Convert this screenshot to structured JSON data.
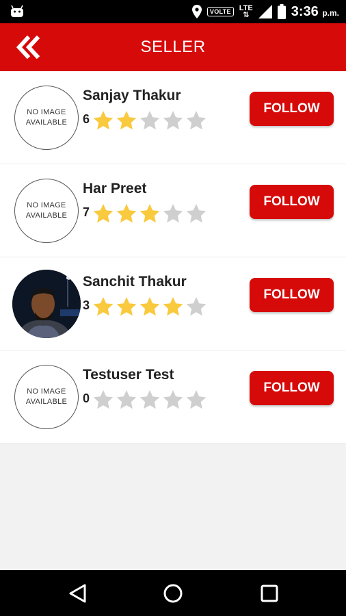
{
  "status_bar": {
    "volte": "VOLTE",
    "network": "LTE",
    "time": "3:36",
    "ampm": "p.m."
  },
  "app_bar": {
    "title": "SELLER",
    "back_icon": "double-chevron-left-icon"
  },
  "colors": {
    "primary_red": "#d70a0a",
    "star_filled": "#f9c93e",
    "star_empty": "#cfcfcf"
  },
  "sellers": [
    {
      "name": "Sanjay Thakur",
      "count": "6",
      "rating": 2,
      "avatar_text_1": "NO IMAGE",
      "avatar_text_2": "AVAILABLE",
      "follow_label": "FOLLOW"
    },
    {
      "name": "Har Preet",
      "count": "7",
      "rating": 3,
      "avatar_text_1": "NO IMAGE",
      "avatar_text_2": "AVAILABLE",
      "follow_label": "FOLLOW"
    },
    {
      "name": "Sanchit Thakur",
      "count": "3",
      "rating": 4,
      "avatar_text_1": "",
      "avatar_text_2": "",
      "follow_label": "FOLLOW"
    },
    {
      "name": "Testuser Test",
      "count": "0",
      "rating": 0,
      "avatar_text_1": "NO IMAGE",
      "avatar_text_2": "AVAILABLE",
      "follow_label": "FOLLOW"
    }
  ],
  "nav_bar": {
    "back": "triangle-back-icon",
    "home": "circle-home-icon",
    "recents": "square-recents-icon"
  }
}
